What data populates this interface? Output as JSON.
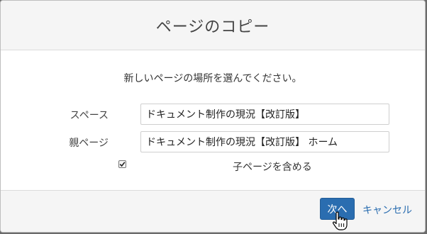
{
  "dialog": {
    "title": "ページのコピー",
    "instruction": "新しいページの場所を選んでください。"
  },
  "form": {
    "space_label": "スペース",
    "space_value": "ドキュメント制作の現況【改訂版】",
    "parent_label": "親ページ",
    "parent_value": "ドキュメント制作の現況【改訂版】 ホーム",
    "include_children_label": "子ページを含める",
    "include_children_checked": true
  },
  "footer": {
    "next_label": "次へ",
    "cancel_label": "キャンセル"
  },
  "colors": {
    "primary": "#2a6db0",
    "header_bg": "#f5f5f5",
    "backdrop": "#6b6b6b"
  },
  "icons": [
    "checkmark-icon",
    "hand-pointer-icon"
  ]
}
